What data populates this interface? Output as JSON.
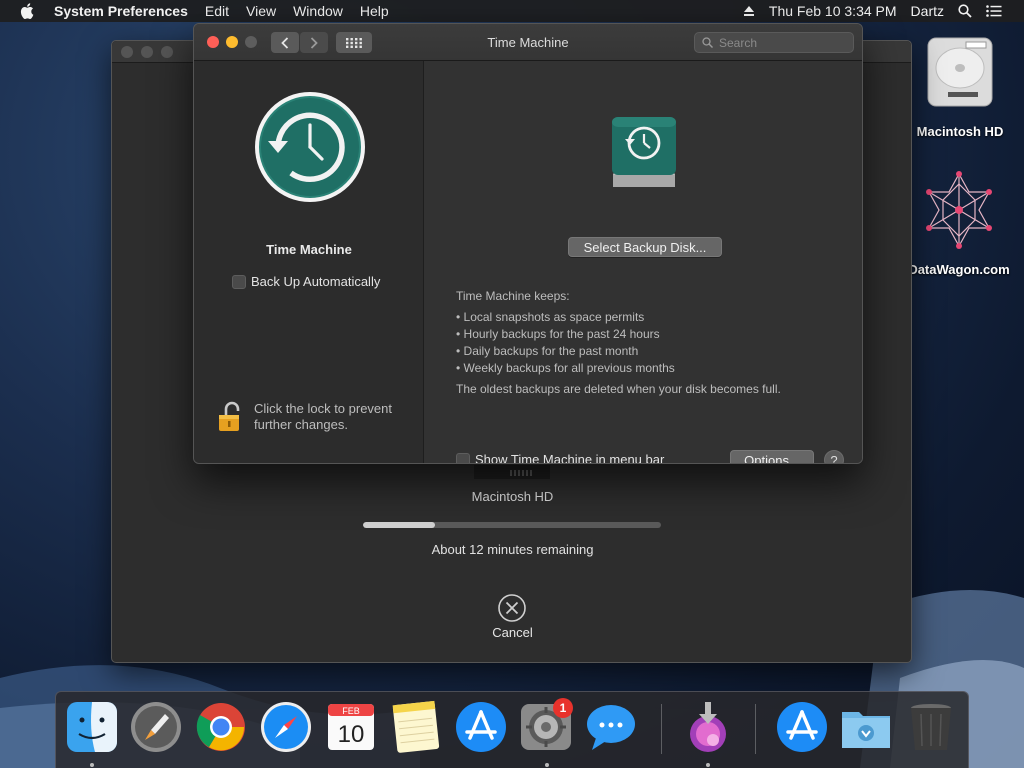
{
  "menubar": {
    "app_name": "System Preferences",
    "menus": [
      "Edit",
      "View",
      "Window",
      "Help"
    ],
    "clock": "Thu Feb 10  3:34 PM",
    "user": "Dartz"
  },
  "desktop": {
    "icons": [
      {
        "label": "Macintosh HD",
        "icon": "hard-drive-icon"
      },
      {
        "label": "DataWagon.com",
        "icon": "network-graphic-icon"
      }
    ]
  },
  "backup_window": {
    "drive_label": "Macintosh HD",
    "progress_percent": 24,
    "remaining": "About 12 minutes remaining",
    "cancel_label": "Cancel"
  },
  "prefs_window": {
    "title": "Time Machine",
    "search_placeholder": "Search",
    "left": {
      "app_name": "Time Machine",
      "auto_backup_label": "Back Up Automatically",
      "auto_backup_checked": false,
      "lock_text": "Click the lock to prevent further changes."
    },
    "right": {
      "select_disk_button": "Select Backup Disk...",
      "keeps_heading": "Time Machine keeps:",
      "keeps_items": [
        "• Local snapshots as space permits",
        "• Hourly backups for the past 24 hours",
        "• Daily backups for the past month",
        "• Weekly backups for all previous months"
      ],
      "oldest_note": "The oldest backups are deleted when your disk becomes full.",
      "menubar_checkbox_label": "Show Time Machine in menu bar",
      "menubar_checked": false,
      "options_button": "Options...",
      "help_label": "?"
    }
  },
  "dock": {
    "items": [
      {
        "name": "finder-icon",
        "running": true
      },
      {
        "name": "launchpad-icon",
        "running": false
      },
      {
        "name": "chrome-icon",
        "running": false
      },
      {
        "name": "safari-icon",
        "running": false
      },
      {
        "name": "calendar-icon",
        "running": false,
        "month": "FEB",
        "day": "10"
      },
      {
        "name": "notes-icon",
        "running": false
      },
      {
        "name": "app-store-icon",
        "running": false
      },
      {
        "name": "system-preferences-icon",
        "running": true,
        "badge": "1"
      },
      {
        "name": "messages-icon",
        "running": false
      },
      {
        "name": "installer-icon",
        "running": true
      },
      {
        "name": "app-store-icon-2",
        "running": false
      },
      {
        "name": "downloads-folder-icon",
        "running": false
      },
      {
        "name": "trash-icon",
        "running": false
      }
    ]
  },
  "colors": {
    "accent_teal": "#1f6f65",
    "badge_red": "#e8322c",
    "close": "#fe5f57",
    "minimize": "#febc2e"
  }
}
